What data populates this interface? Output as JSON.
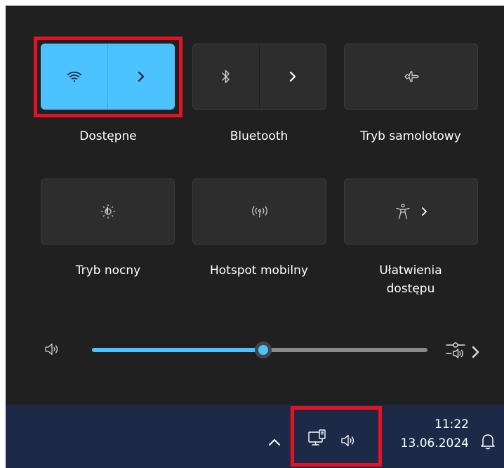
{
  "quick_settings": {
    "tiles": [
      {
        "id": "wifi",
        "label": "Dostępne",
        "icon": "wifi-icon",
        "state": "on",
        "has_chevron": true
      },
      {
        "id": "bluetooth",
        "label": "Bluetooth",
        "icon": "bluetooth-icon",
        "state": "off",
        "has_chevron": true
      },
      {
        "id": "airplane",
        "label": "Tryb samolotowy",
        "icon": "airplane-icon",
        "state": "off",
        "has_chevron": false
      },
      {
        "id": "night",
        "label": "Tryb nocny",
        "icon": "brightness-icon",
        "state": "off",
        "has_chevron": false
      },
      {
        "id": "hotspot",
        "label": "Hotspot mobilny",
        "icon": "hotspot-icon",
        "state": "off",
        "has_chevron": false
      },
      {
        "id": "accessibility",
        "label_line1": "Ułatwienia",
        "label_line2": "dostępu",
        "icon": "accessibility-icon",
        "state": "off",
        "has_chevron": true
      }
    ],
    "volume": {
      "level_percent": 51,
      "icon": "speaker-icon",
      "output_icon": "audio-output-icon"
    }
  },
  "taskbar": {
    "time": "11:22",
    "date": "13.06.2024",
    "tray_icons": [
      "chevron-up-icon",
      "network-icon",
      "speaker-icon",
      "bell-icon"
    ]
  },
  "colors": {
    "accent": "#4cc2ff",
    "panel": "#202020",
    "tile": "#2d2d2d",
    "taskbar": "#1c2a48",
    "highlight": "#e81123"
  }
}
